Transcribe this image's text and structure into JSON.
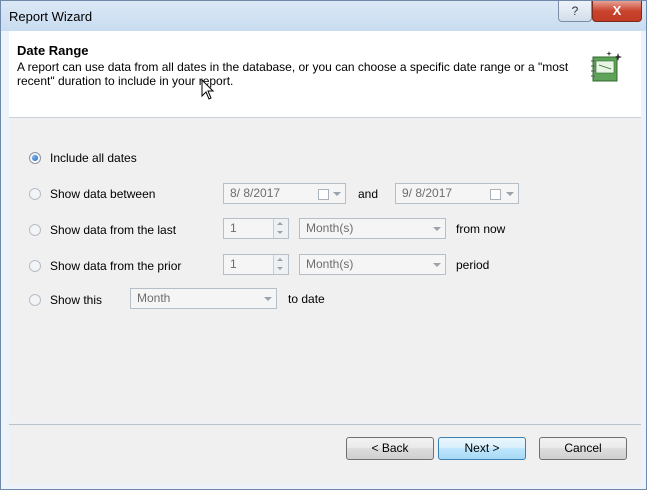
{
  "window": {
    "title": "Report Wizard",
    "help_glyph": "?",
    "close_glyph": "X"
  },
  "header": {
    "title": "Date Range",
    "description": "A report can use data from all dates in the database, or you can choose a specific date range or a \"most recent\" duration to include in your report.",
    "icon": "wizard-calendar-icon"
  },
  "options": {
    "all_dates": {
      "label": "Include all dates",
      "selected": true
    },
    "between": {
      "label": "Show data between",
      "start_date": "8/ 8/2017",
      "and_label": "and",
      "end_date": "9/ 8/2017"
    },
    "last": {
      "label": "Show data from the last",
      "count": "1",
      "unit": "Month(s)",
      "suffix": "from now"
    },
    "prior": {
      "label": "Show data from the prior",
      "count": "1",
      "unit": "Month(s)",
      "suffix": "period"
    },
    "this": {
      "label": "Show this",
      "unit": "Month",
      "suffix": "to date"
    }
  },
  "buttons": {
    "back": "< Back",
    "next": "Next >",
    "cancel": "Cancel"
  }
}
